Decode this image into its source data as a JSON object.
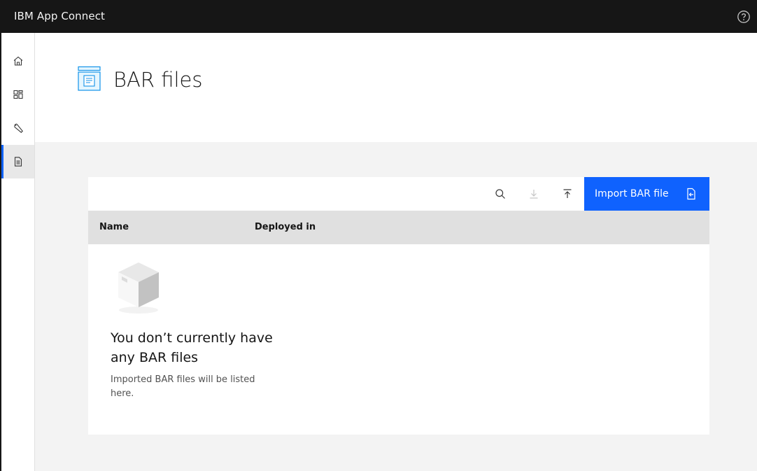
{
  "topbar": {
    "brand_ibm": "IBM",
    "brand_product": "App Connect"
  },
  "sidenav": {
    "items": [
      {
        "name": "home",
        "icon": "home-icon"
      },
      {
        "name": "dashboard",
        "icon": "dashboard-icon"
      },
      {
        "name": "tools",
        "icon": "wrench-icon"
      },
      {
        "name": "bar-files",
        "icon": "document-icon",
        "active": true
      }
    ]
  },
  "page": {
    "title": "BAR files"
  },
  "toolbar": {
    "import_label": "Import BAR file"
  },
  "table": {
    "columns": [
      "Name",
      "Deployed in"
    ]
  },
  "empty_state": {
    "title": "You don’t currently have any BAR files",
    "description": "Imported BAR files will be listed here."
  },
  "colors": {
    "topbar": "#161616",
    "accent": "#0f62fe",
    "page_bg": "#f3f3f3",
    "table_header": "#e0e0e0"
  }
}
